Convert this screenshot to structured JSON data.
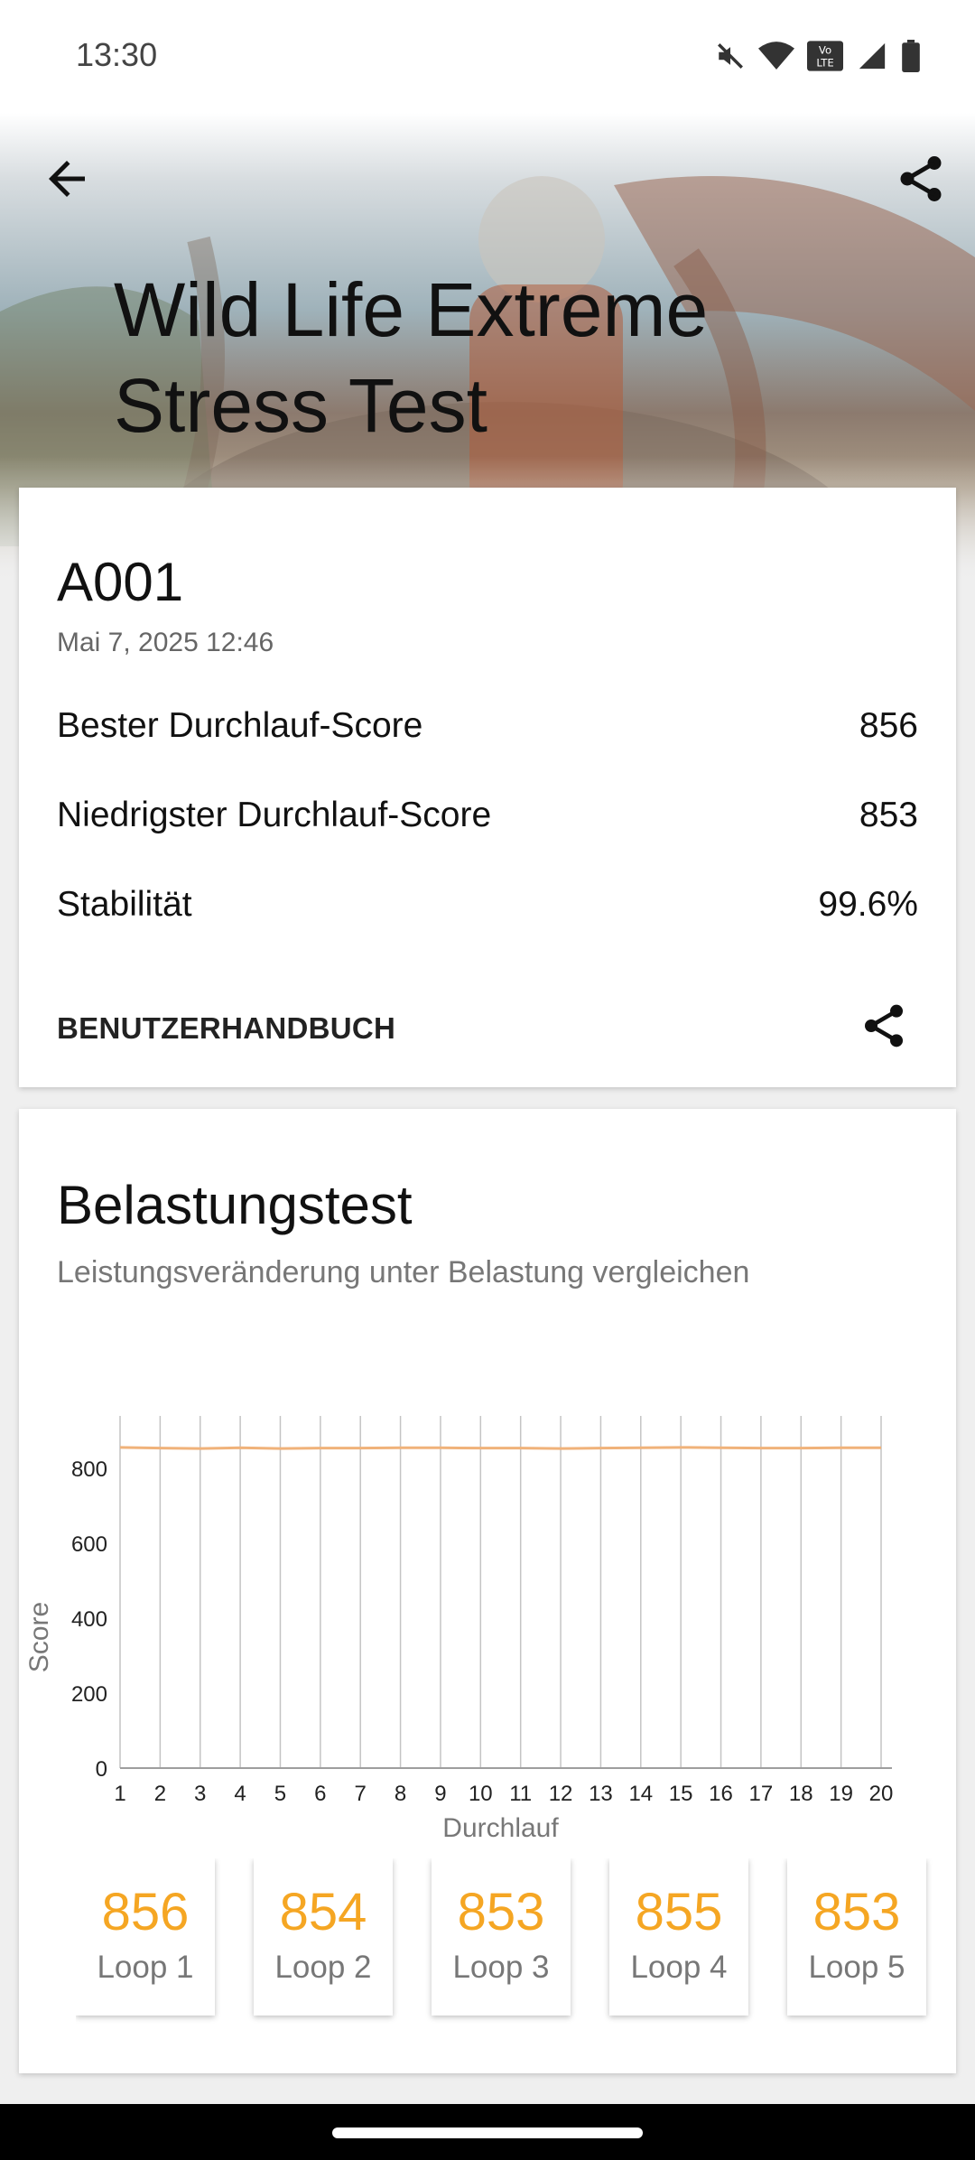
{
  "status": {
    "time": "13:30"
  },
  "header": {
    "title": "Wild Life Extreme Stress Test"
  },
  "result": {
    "device": "A001",
    "date": "Mai 7, 2025 12:46",
    "stats": [
      {
        "label": "Bester Durchlauf-Score",
        "value": "856"
      },
      {
        "label": "Niedrigster Durchlauf-Score",
        "value": "853"
      },
      {
        "label": "Stabilität",
        "value": "99.6%"
      }
    ],
    "manual_label": "BENUTZERHANDBUCH"
  },
  "stress": {
    "title": "Belastungstest",
    "subtitle": "Leistungsveränderung unter Belastung vergleichen"
  },
  "colors": {
    "accent": "#f5a623",
    "line": "#f0b27a"
  },
  "icons": [
    "back-arrow-icon",
    "share-icon",
    "mute-icon",
    "wifi-icon",
    "volte-icon",
    "signal-icon",
    "battery-icon"
  ],
  "chart_data": {
    "type": "line",
    "xlabel": "Durchlauf",
    "ylabel": "Score",
    "ylim": [
      0,
      940
    ],
    "y_ticks": [
      0,
      200,
      400,
      600,
      800
    ],
    "x": [
      1,
      2,
      3,
      4,
      5,
      6,
      7,
      8,
      9,
      10,
      11,
      12,
      13,
      14,
      15,
      16,
      17,
      18,
      19,
      20
    ],
    "series": [
      {
        "values": [
          856,
          854,
          853,
          855,
          853,
          854,
          854,
          855,
          855,
          854,
          854,
          853,
          854,
          855,
          856,
          855,
          854,
          854,
          855,
          855
        ]
      }
    ],
    "grid": "vertical"
  },
  "loops": [
    {
      "score": "856",
      "label": "Loop 1"
    },
    {
      "score": "854",
      "label": "Loop 2"
    },
    {
      "score": "853",
      "label": "Loop 3"
    },
    {
      "score": "855",
      "label": "Loop 4"
    },
    {
      "score": "853",
      "label": "Loop 5"
    }
  ]
}
